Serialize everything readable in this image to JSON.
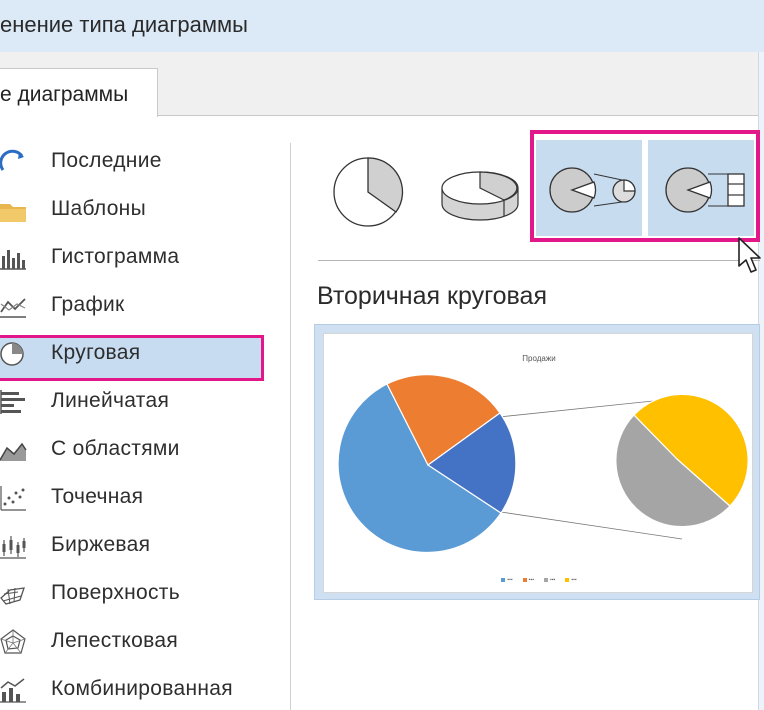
{
  "window": {
    "title": "енение типа диаграммы"
  },
  "tabs": [
    {
      "label": "е диаграммы"
    }
  ],
  "sidebar": {
    "items": [
      {
        "label": "Последние",
        "icon": "recent-icon"
      },
      {
        "label": "Шаблоны",
        "icon": "folder-icon"
      },
      {
        "label": "Гистограмма",
        "icon": "column-chart-icon"
      },
      {
        "label": "График",
        "icon": "line-chart-icon"
      },
      {
        "label": "Круговая",
        "icon": "pie-chart-icon",
        "selected": true
      },
      {
        "label": "Линейчатая",
        "icon": "bar-chart-icon"
      },
      {
        "label": "С областями",
        "icon": "area-chart-icon"
      },
      {
        "label": "Точечная",
        "icon": "scatter-chart-icon"
      },
      {
        "label": "Биржевая",
        "icon": "stock-chart-icon"
      },
      {
        "label": "Поверхность",
        "icon": "surface-chart-icon"
      },
      {
        "label": "Лепестковая",
        "icon": "radar-chart-icon"
      },
      {
        "label": "Комбинированная",
        "icon": "combo-chart-icon"
      }
    ]
  },
  "subtypes": [
    {
      "icon": "pie-icon",
      "selected": false
    },
    {
      "icon": "pie-3d-icon",
      "selected": false
    },
    {
      "icon": "pie-of-pie-icon",
      "selected": true
    },
    {
      "icon": "bar-of-pie-icon",
      "selected": true
    }
  ],
  "preview": {
    "name": "Вторичная круговая",
    "chart_title": "Продажи",
    "legend_colors": [
      "#5b9bd5",
      "#ed7d31",
      "#a5a5a5",
      "#ffc000"
    ]
  },
  "colors": {
    "accent_highlight": "#e2178a",
    "selection": "#c7dcf1",
    "pie_blue": "#5b9bd5",
    "pie_orange": "#ed7d31",
    "pie_darkblue": "#4472c4",
    "pie_gray": "#a5a5a5",
    "pie_yellow": "#ffc000"
  }
}
